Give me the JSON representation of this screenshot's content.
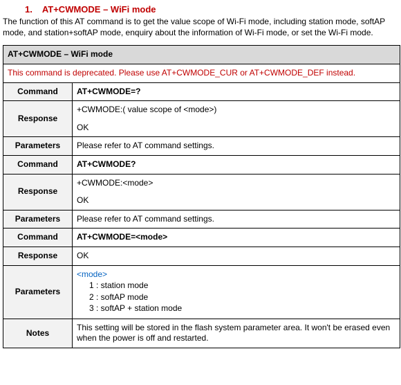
{
  "heading": {
    "number": "1.",
    "title": "AT+CWMODE – WiFi mode"
  },
  "intro": "The function of this AT command is to get the value scope of Wi-Fi mode, including station mode, softAP mode, and station+softAP mode, enquiry about the information of Wi-Fi mode, or set the Wi-Fi mode.",
  "table": {
    "title": "AT+CWMODE – WiFi mode",
    "deprecated": "This command is deprecated. Please use AT+CWMODE_CUR or AT+CWMODE_DEF instead.",
    "labels": {
      "command": "Command",
      "response": "Response",
      "parameters": "Parameters",
      "notes": "Notes"
    },
    "sections": [
      {
        "command": "AT+CWMODE=?",
        "response_line1": "+CWMODE:( value scope of <mode>)",
        "response_ok": "OK",
        "parameters_text": "Please refer to AT command settings."
      },
      {
        "command": "AT+CWMODE?",
        "response_line1": "+CWMODE:<mode>",
        "response_ok": "OK",
        "parameters_text": "Please refer to AT command settings."
      },
      {
        "command": "AT+CWMODE=<mode>",
        "response_line1": "OK",
        "parameters_tag": "<mode>",
        "parameters_list": [
          "1 :  station mode",
          "2 :  softAP mode",
          "3 :  softAP + station mode"
        ]
      }
    ],
    "notes": "This setting will be stored in the flash system parameter area. It won't be erased even when the power is off and restarted."
  }
}
